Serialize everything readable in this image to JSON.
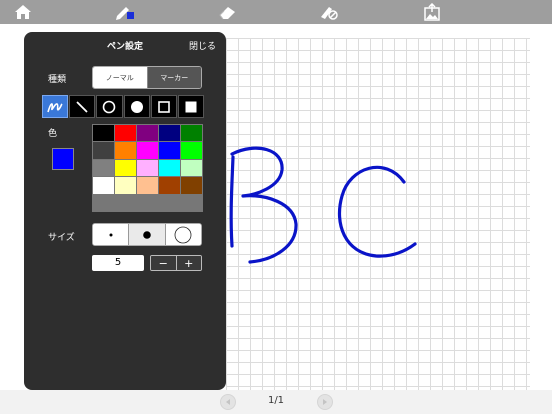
{
  "toolbar": {
    "buttons": [
      {
        "name": "home-icon"
      },
      {
        "name": "pen-settings-icon"
      },
      {
        "name": "eraser-icon"
      },
      {
        "name": "clear-icon"
      },
      {
        "name": "export-image-icon"
      }
    ]
  },
  "pen_panel": {
    "title": "ペン設定",
    "close_label": "閉じる",
    "type_label": "種類",
    "type_options": [
      "ノーマル",
      "マーカー"
    ],
    "type_selected": "ノーマル",
    "tools": [
      "freehand-tool-icon",
      "line-tool-icon",
      "circle-outline-tool-icon",
      "circle-filled-tool-icon",
      "rectangle-outline-tool-icon",
      "rectangle-filled-tool-icon"
    ],
    "selected_tool": "freehand-tool-icon",
    "color_label": "色",
    "current_color": "#0000ff",
    "palette": [
      "#000000",
      "#ff0000",
      "#800080",
      "#000080",
      "#008000",
      "#404040",
      "#ff8000",
      "#ff00ff",
      "#0000ff",
      "#00ff00",
      "#808080",
      "#ffff00",
      "#ffb0ff",
      "#00ffff",
      "#c0ffc0",
      "#ffffff",
      "#ffffc0",
      "#ffc090",
      "#a04000",
      "#804000"
    ],
    "size_label": "サイズ",
    "size_options": [
      "small",
      "medium",
      "large"
    ],
    "size_selected": "medium",
    "size_value": "5",
    "minus_label": "−",
    "plus_label": "+"
  },
  "canvas": {
    "ink_color": "#0a14c8"
  },
  "pager": {
    "indicator": "1/1"
  }
}
